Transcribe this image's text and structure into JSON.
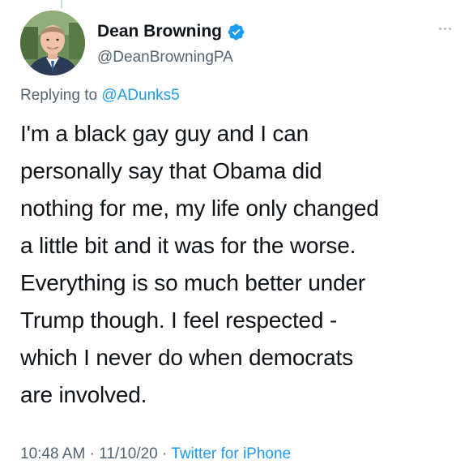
{
  "author": {
    "display_name": "Dean Browning",
    "handle": "@DeanBrowningPA",
    "verified": true
  },
  "reply": {
    "prefix": "Replying to ",
    "mention": "@ADunks5"
  },
  "tweet": {
    "lines": [
      "I'm a black gay guy and I can",
      "personally say that Obama did",
      "nothing for me, my life only changed",
      "a little bit and it was for the worse.",
      "Everything is so much better under",
      "Trump though. I feel respected -",
      "which I never do when democrats",
      "are involved."
    ]
  },
  "meta": {
    "time": "10:48 AM",
    "separator": " · ",
    "date": "11/10/20",
    "source": "Twitter for iPhone"
  },
  "colors": {
    "text": "#0f1419",
    "secondary": "#536471",
    "accent": "#1d9bf0"
  },
  "icons": {
    "verified": "verified-badge-icon",
    "more": "more-options-icon"
  }
}
